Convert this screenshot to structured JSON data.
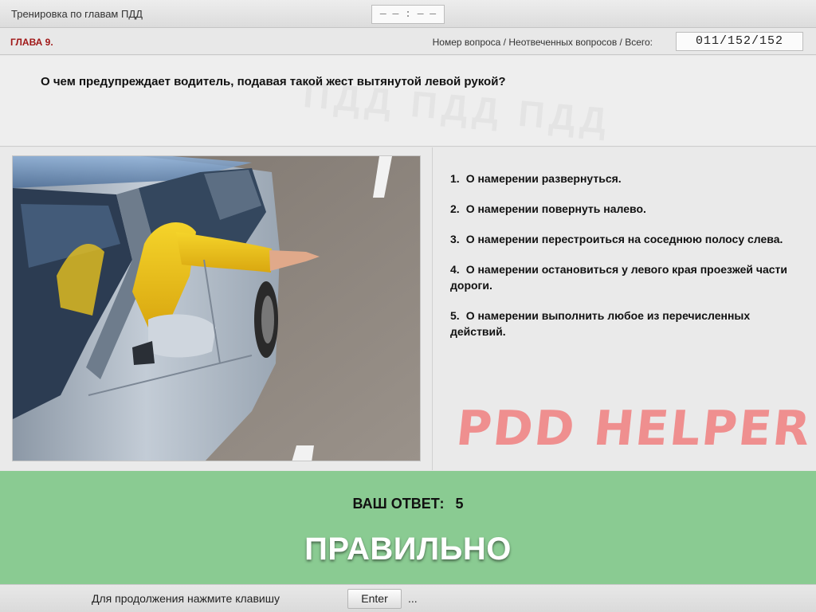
{
  "header": {
    "app_title": "Тренировка по главам ПДД",
    "timer": "— — : — —"
  },
  "info": {
    "chapter": "ГЛАВА 9.",
    "counter_label": "Номер вопроса / Неотвеченных вопросов / Всего:",
    "counter_value": "011/152/152"
  },
  "question": {
    "text": "О чем предупреждает водитель, подавая такой жест вытянутой левой рукой?"
  },
  "answers": [
    {
      "num": "1.",
      "text": "О намерении развернуться."
    },
    {
      "num": "2.",
      "text": "О намерении повернуть налево."
    },
    {
      "num": "3.",
      "text": "О намерении перестроиться на соседнюю полосу слева."
    },
    {
      "num": "4.",
      "text": "О намерении остановиться у левого края проезжей части дороги."
    },
    {
      "num": "5.",
      "text": "О намерении выполнить любое из перечисленных действий."
    }
  ],
  "watermark": "PDD HELPER",
  "result": {
    "label": "ВАШ ОТВЕТ:",
    "value": "5",
    "verdict": "ПРАВИЛЬНО",
    "color": "#8acb92"
  },
  "footer": {
    "prompt": "Для продолжения нажмите клавишу",
    "key": "Enter",
    "ellipsis": "..."
  },
  "colors": {
    "chapter": "#a01818",
    "watermark": "#ef8f8f"
  }
}
